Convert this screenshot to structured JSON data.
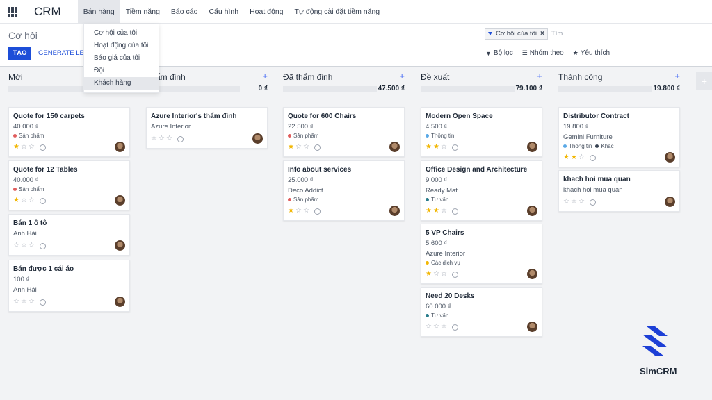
{
  "nav": {
    "brand": "CRM",
    "menu": [
      "Bán hàng",
      "Tiềm năng",
      "Báo cáo",
      "Cấu hình",
      "Hoạt động",
      "Tự động cài đặt tiềm năng"
    ],
    "dropdown": [
      "Cơ hội của tôi",
      "Hoạt động của tôi",
      "Báo giá của tôi",
      "Đội",
      "Khách hàng"
    ]
  },
  "control": {
    "breadcrumb": "Cơ hội",
    "create_label": "TẠO",
    "generate_label": "GENERATE LEA",
    "facet_label": "Cơ hội của tôi",
    "search_placeholder": "Tìm...",
    "filter_label": "Bộ lọc",
    "group_label": "Nhóm theo",
    "fav_label": "Yêu thích"
  },
  "columns": [
    {
      "name": "Mới",
      "total": "",
      "fill": 0
    },
    {
      "name": "Thẩm định",
      "total": "0 ₫",
      "fill": 0
    },
    {
      "name": "Đã thẩm định",
      "total": "47.500 ₫",
      "fill": 0
    },
    {
      "name": "Đề xuất",
      "total": "79.100 ₫",
      "fill": 0
    },
    {
      "name": "Thành công",
      "total": "19.800 ₫",
      "fill": 0
    }
  ],
  "cards": [
    [
      {
        "title": "Quote for 150 carpets",
        "lines": [
          "40.000 ₫"
        ],
        "tags": [
          {
            "label": "Sản phẩm",
            "color": "#e05d5d"
          }
        ],
        "stars": 1
      },
      {
        "title": "Quote for 12 Tables",
        "lines": [
          "40.000 ₫"
        ],
        "tags": [
          {
            "label": "Sản phẩm",
            "color": "#e05d5d"
          }
        ],
        "stars": 1
      },
      {
        "title": "Bán 1 ô tô",
        "lines": [
          "Anh Hải"
        ],
        "tags": [],
        "stars": 0
      },
      {
        "title": "Bán được 1 cái áo",
        "lines": [
          "100 ₫",
          "Anh Hải"
        ],
        "tags": [],
        "stars": 0
      }
    ],
    [
      {
        "title": "Azure Interior's thẩm định",
        "lines": [
          "Azure Interior"
        ],
        "tags": [],
        "stars": 0
      }
    ],
    [
      {
        "title": "Quote for 600 Chairs",
        "lines": [
          "22.500 ₫"
        ],
        "tags": [
          {
            "label": "Sản phẩm",
            "color": "#e05d5d"
          }
        ],
        "stars": 1
      },
      {
        "title": "Info about services",
        "lines": [
          "25.000 ₫",
          "Deco Addict"
        ],
        "tags": [
          {
            "label": "Sản phẩm",
            "color": "#e05d5d"
          }
        ],
        "stars": 1
      }
    ],
    [
      {
        "title": "Modern Open Space",
        "lines": [
          "4.500 ₫"
        ],
        "tags": [
          {
            "label": "Thông tin",
            "color": "#5aa9e6"
          }
        ],
        "stars": 2
      },
      {
        "title": "Office Design and Architecture",
        "lines": [
          "9.000 ₫",
          "Ready Mat"
        ],
        "tags": [
          {
            "label": "Tư vấn",
            "color": "#2a7d8c"
          }
        ],
        "stars": 2
      },
      {
        "title": "5 VP Chairs",
        "lines": [
          "5.600 ₫",
          "Azure Interior"
        ],
        "tags": [
          {
            "label": "Các dịch vụ",
            "color": "#f2b705"
          }
        ],
        "stars": 1
      },
      {
        "title": "Need 20 Desks",
        "lines": [
          "60.000 ₫"
        ],
        "tags": [
          {
            "label": "Tư vấn",
            "color": "#2a7d8c"
          }
        ],
        "stars": 0
      }
    ],
    [
      {
        "title": "Distributor Contract",
        "lines": [
          "19.800 ₫",
          "Gemini Furniture"
        ],
        "tags": [
          {
            "label": "Thông tin",
            "color": "#5aa9e6"
          },
          {
            "label": "Khác",
            "color": "#374151"
          }
        ],
        "stars": 2
      },
      {
        "title": "khach hoi mua quan",
        "lines": [
          "khach hoi mua quan"
        ],
        "tags": [],
        "stars": 0
      }
    ]
  ],
  "logo": {
    "text": "SimCRM",
    "color": "#1d3fd6"
  }
}
